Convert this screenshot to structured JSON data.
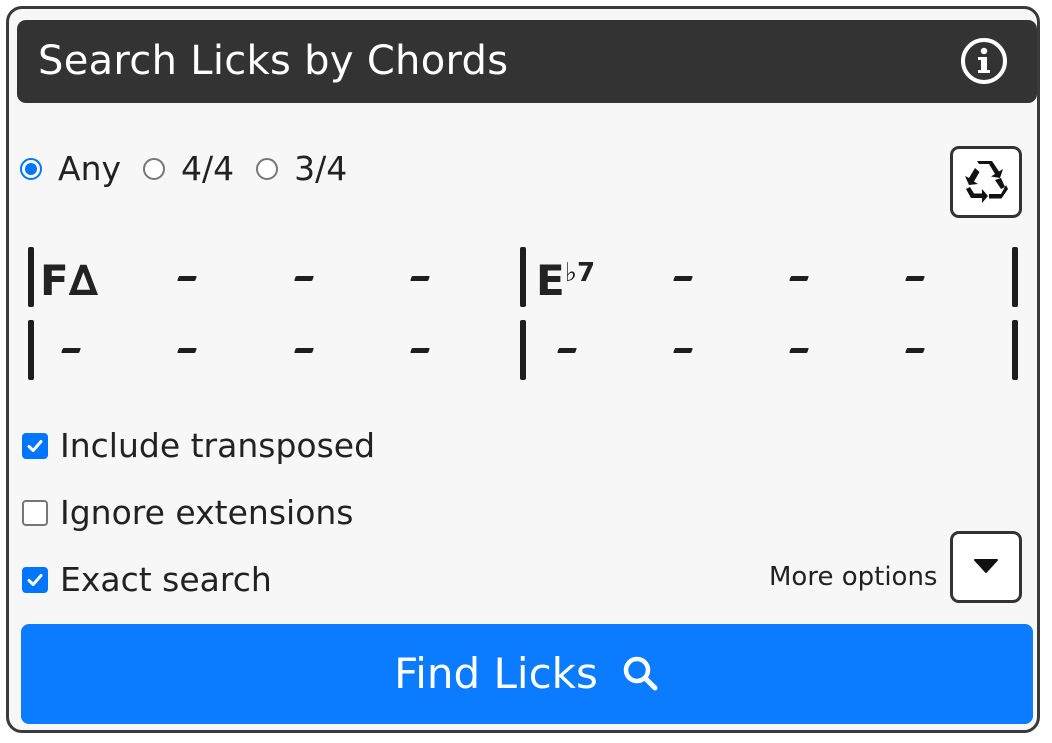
{
  "header": {
    "title": "Search Licks by Chords"
  },
  "time_signature": {
    "options": [
      {
        "label": "Any",
        "checked": true
      },
      {
        "label": "4/4",
        "checked": false
      },
      {
        "label": "3/4",
        "checked": false
      }
    ]
  },
  "chord_grid": {
    "chords": [
      {
        "root": "F",
        "quality": "∆"
      },
      {
        "root": "E",
        "quality": "♭7"
      }
    ]
  },
  "options": {
    "include_transposed": {
      "label": "Include transposed",
      "checked": true
    },
    "ignore_extensions": {
      "label": "Ignore extensions",
      "checked": false
    },
    "exact_search": {
      "label": "Exact search",
      "checked": true
    },
    "more_options_label": "More options"
  },
  "find_button": {
    "label": "Find Licks"
  },
  "colors": {
    "header_bg": "#333333",
    "accent": "#0b7cff",
    "panel_bg": "#f7f7f7"
  },
  "icons": [
    "info-icon",
    "recycle-icon",
    "caret-down-icon",
    "search-icon"
  ]
}
